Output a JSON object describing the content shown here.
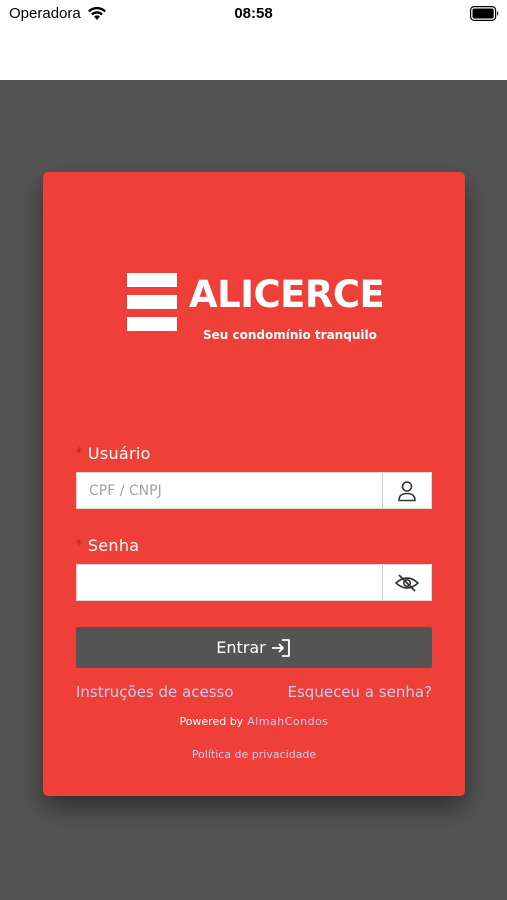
{
  "status_bar": {
    "carrier": "Operadora",
    "time": "08:58",
    "wifi_icon": "wifi-icon",
    "battery_icon": "battery-icon"
  },
  "brand": {
    "name": "ALICERCE",
    "tagline": "Seu condomínio tranquilo",
    "logo_icon": "stacked-bars-logo"
  },
  "form": {
    "username": {
      "required_mark": "*",
      "label": "Usuário",
      "placeholder": "CPF / CNPJ",
      "value": "",
      "icon": "user-icon"
    },
    "password": {
      "required_mark": "*",
      "label": "Senha",
      "placeholder": "",
      "value": "",
      "icon": "eye-off-icon"
    },
    "submit_label": "Entrar",
    "submit_icon": "login-icon"
  },
  "links": {
    "access_instructions": "Instruções de acesso",
    "forgot_password": "Esqueceu a senha?"
  },
  "footer": {
    "powered_by": "Powered by",
    "powered_brand": "AlmahCondos",
    "privacy": "Política de privacidade"
  },
  "colors": {
    "card": "#ee4038",
    "backdrop": "#545454",
    "button": "#545454",
    "link": "#c8cdee"
  }
}
